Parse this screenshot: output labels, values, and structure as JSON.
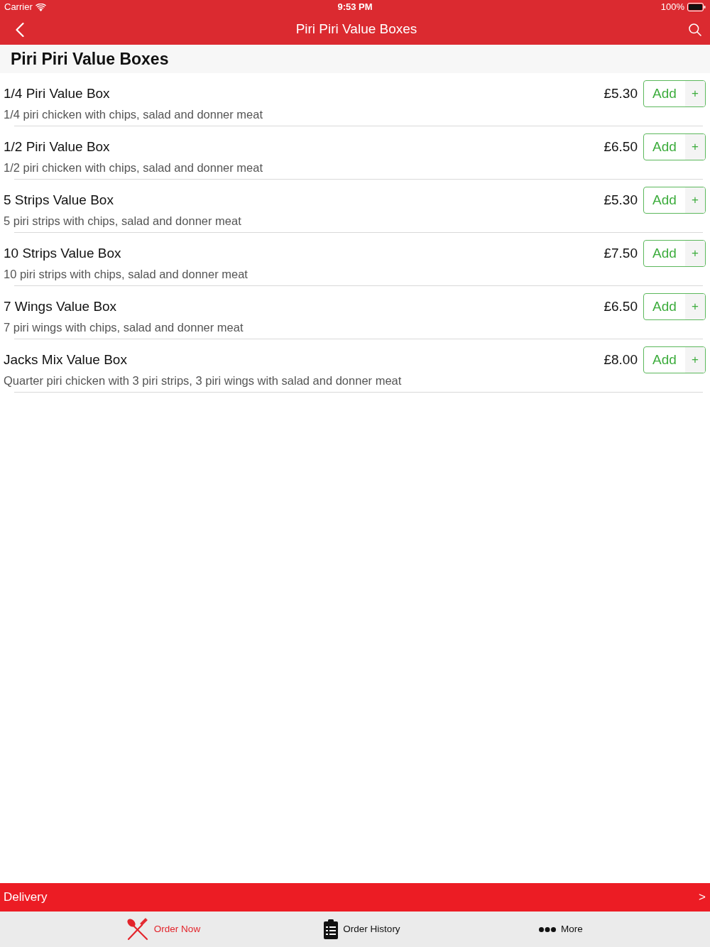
{
  "status_bar": {
    "carrier": "Carrier",
    "time": "9:53 PM",
    "battery": "100%"
  },
  "nav_bar": {
    "title": "Piri Piri Value Boxes"
  },
  "section": {
    "title": "Piri Piri Value Boxes"
  },
  "items": [
    {
      "name": "1/4 Piri Value Box",
      "description": "1/4 piri chicken with chips, salad and donner meat",
      "price": "£5.30",
      "button": "Add",
      "plus": "+"
    },
    {
      "name": "1/2 Piri Value Box",
      "description": "1/2 piri chicken with chips, salad and donner meat",
      "price": "£6.50",
      "button": "Add",
      "plus": "+"
    },
    {
      "name": "5 Strips Value Box",
      "description": "5 piri strips with chips, salad and donner meat",
      "price": "£5.30",
      "button": "Add",
      "plus": "+"
    },
    {
      "name": "10 Strips Value Box",
      "description": "10 piri strips with chips, salad and donner meat",
      "price": "£7.50",
      "button": "Add",
      "plus": "+"
    },
    {
      "name": "7 Wings Value Box",
      "description": "7 piri wings with chips, salad and donner meat",
      "price": "£6.50",
      "button": "Add",
      "plus": "+"
    },
    {
      "name": "Jacks Mix Value Box",
      "description": "Quarter piri chicken with 3 piri strips, 3 piri wings with salad and donner meat",
      "price": "£8.00",
      "button": "Add",
      "plus": "+"
    }
  ],
  "delivery_bar": {
    "label": "Delivery",
    "chevron": ">"
  },
  "tab_bar": [
    {
      "label": "Order Now",
      "selected": true
    },
    {
      "label": "Order History",
      "selected": false
    },
    {
      "label": "More",
      "selected": false
    }
  ]
}
